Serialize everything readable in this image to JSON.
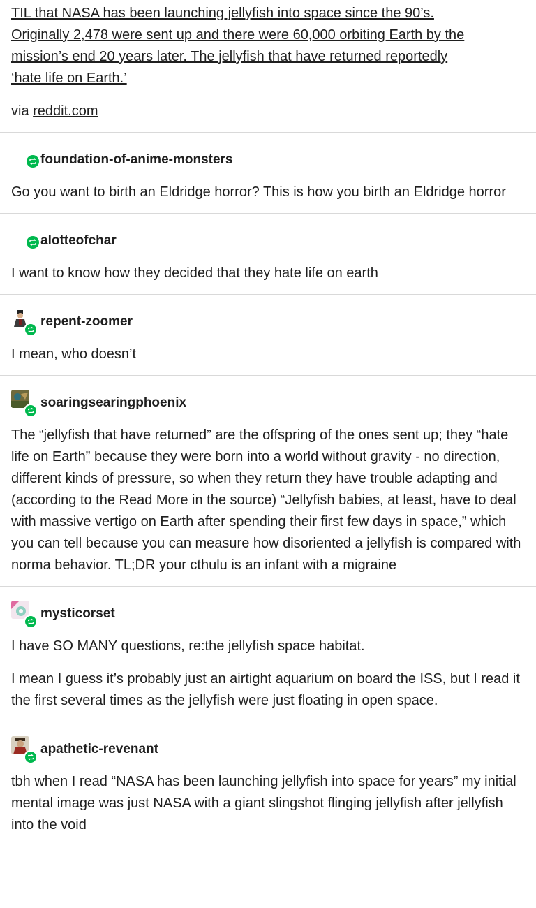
{
  "op": {
    "lines": [
      "TIL that NASA has been launching jellyfish into space since the 90’s.",
      "Originally 2,478 were sent up and there were 60,000 orbiting Earth by the",
      "mission’s end 20 years later. The jellyfish that have returned reportedly",
      "‘hate life on Earth.’"
    ],
    "via_prefix": "via ",
    "via_link": "reddit.com"
  },
  "reblogs": [
    {
      "username": "foundation-of-anime-monsters",
      "paragraphs": [
        "Go you want to birth an Eldridge horror? This is how you birth an Eldridge horror"
      ]
    },
    {
      "username": "alotteofchar",
      "paragraphs": [
        "I want to know how they decided that they hate life on earth"
      ]
    },
    {
      "username": "repent-zoomer",
      "paragraphs": [
        "I mean, who doesn’t"
      ]
    },
    {
      "username": "soaringsearingphoenix",
      "paragraphs": [
        "The “jellyfish that have returned” are the offspring of the ones sent up; they “hate life on Earth” because they were born into a world without gravity - no direction, different kinds of pressure, so when they return they have trouble adapting and (according to the Read More in the source) “Jellyfish babies, at least, have to deal with massive vertigo on Earth after spending their first few days in space,” which you can tell because you can measure how disoriented a jellyfish is compared with norma behavior. TL;DR your cthulu is an infant with a migraine"
      ]
    },
    {
      "username": "mysticorset",
      "paragraphs": [
        "I have SO MANY questions, re:the jellyfish space habitat.",
        "I mean I guess it’s probably just an airtight aquarium on board the ISS, but I read it the first several times as the jellyfish were just floating in open space."
      ]
    },
    {
      "username": "apathetic-revenant",
      "paragraphs": [
        "tbh when I read “NASA has been launching jellyfish into space for years” my initial mental image was just NASA with a giant slingshot flinging jellyfish after jellyfish into the void"
      ]
    }
  ],
  "icons": {
    "reblog": "reblog-icon",
    "avatar": "avatar-icon"
  },
  "colors": {
    "reblog_badge": "#00b84e",
    "divider": "#d9d9d9",
    "text": "#1f1f1f"
  }
}
